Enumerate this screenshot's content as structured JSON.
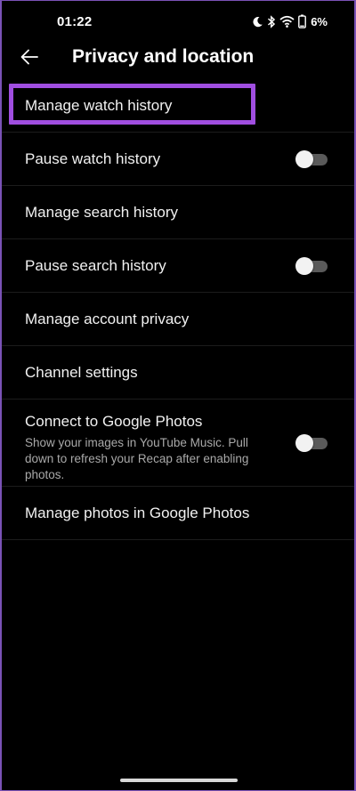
{
  "status_bar": {
    "time": "01:22",
    "battery_percent": "6%",
    "icons": [
      "moon-icon",
      "bluetooth-icon",
      "wifi-icon",
      "battery-icon"
    ]
  },
  "app_bar": {
    "back_icon": "back-arrow-icon",
    "title": "Privacy and location"
  },
  "colors": {
    "background": "#000000",
    "highlight_border": "#a04ee0",
    "toggle_off_track": "#5a5a5a",
    "toggle_off_thumb": "#f2f2f2"
  },
  "settings": [
    {
      "label": "Manage watch history",
      "highlighted": true
    },
    {
      "label": "Pause watch history",
      "toggle": false
    },
    {
      "label": "Manage search history"
    },
    {
      "label": "Pause search history",
      "toggle": false
    },
    {
      "label": "Manage account privacy"
    },
    {
      "label": "Channel settings"
    },
    {
      "label": "Connect to Google Photos",
      "description": "Show your images in YouTube Music. Pull down to refresh your Recap after enabling photos.",
      "toggle": false
    },
    {
      "label": "Manage photos in Google Photos"
    }
  ]
}
